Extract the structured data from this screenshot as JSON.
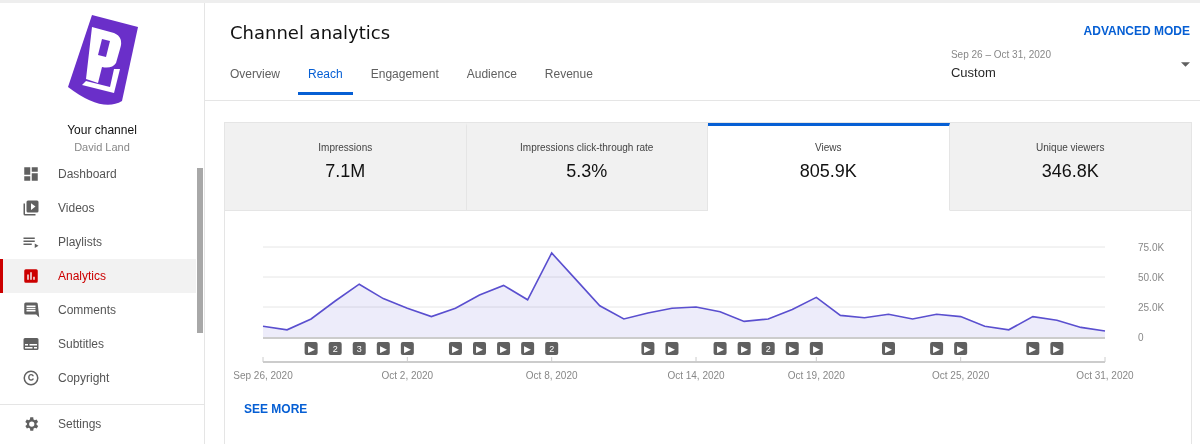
{
  "sidebar": {
    "channel_label": "Your channel",
    "channel_name": "David Land",
    "items": [
      {
        "label": "Dashboard",
        "selected": false
      },
      {
        "label": "Videos",
        "selected": false
      },
      {
        "label": "Playlists",
        "selected": false
      },
      {
        "label": "Analytics",
        "selected": true
      },
      {
        "label": "Comments",
        "selected": false
      },
      {
        "label": "Subtitles",
        "selected": false
      },
      {
        "label": "Copyright",
        "selected": false
      }
    ],
    "footer_items": [
      {
        "label": "Settings",
        "selected": false
      }
    ]
  },
  "header": {
    "title": "Channel analytics",
    "advanced_link": "ADVANCED MODE",
    "date_range": "Sep 26 – Oct 31, 2020",
    "period": "Custom"
  },
  "tabs": [
    {
      "label": "Overview",
      "selected": false
    },
    {
      "label": "Reach",
      "selected": true
    },
    {
      "label": "Engagement",
      "selected": false
    },
    {
      "label": "Audience",
      "selected": false
    },
    {
      "label": "Revenue",
      "selected": false
    }
  ],
  "metrics": [
    {
      "label": "Impressions",
      "value": "7.1M",
      "selected": false
    },
    {
      "label": "Impressions click-through rate",
      "value": "5.3%",
      "selected": false
    },
    {
      "label": "Views",
      "value": "805.9K",
      "selected": true
    },
    {
      "label": "Unique viewers",
      "value": "346.8K",
      "selected": false
    }
  ],
  "chart": {
    "chart_data": {
      "type": "area",
      "categories": [
        "Sep 26, 2020",
        null,
        null,
        null,
        null,
        null,
        "Oct 2, 2020",
        null,
        null,
        null,
        null,
        null,
        "Oct 8, 2020",
        null,
        null,
        null,
        null,
        null,
        "Oct 14, 2020",
        null,
        null,
        null,
        null,
        "Oct 19, 2020",
        null,
        null,
        null,
        null,
        null,
        "Oct 25, 2020",
        null,
        null,
        null,
        null,
        null,
        "Oct 31, 2020"
      ],
      "series": [
        {
          "color": "#5a4fcf",
          "values": [
            9000,
            6000,
            15000,
            30000,
            44000,
            32000,
            24000,
            17000,
            24000,
            35000,
            43000,
            31000,
            70000,
            48000,
            26000,
            15000,
            20000,
            24000,
            25000,
            21000,
            13000,
            15000,
            23000,
            33000,
            18000,
            16000,
            19000,
            15000,
            19000,
            17000,
            9000,
            6000,
            17000,
            14000,
            8000,
            5000
          ]
        }
      ],
      "ylim": [
        0,
        75000
      ],
      "yticks": [
        {
          "value": 0,
          "label": "0"
        },
        {
          "value": 25000,
          "label": "25.0K"
        },
        {
          "value": 50000,
          "label": "50.0K"
        },
        {
          "value": 75000,
          "label": "75.0K"
        }
      ],
      "annotations": [
        "▶",
        "2",
        "3",
        "▶",
        "▶",
        "▶",
        "▶",
        "▶",
        "▶",
        "2",
        "▶",
        "▶",
        "▶",
        "▶",
        "2",
        "▶",
        "▶",
        "▶",
        "▶",
        "▶",
        "▶",
        "▶"
      ]
    },
    "see_more": "SEE MORE"
  }
}
